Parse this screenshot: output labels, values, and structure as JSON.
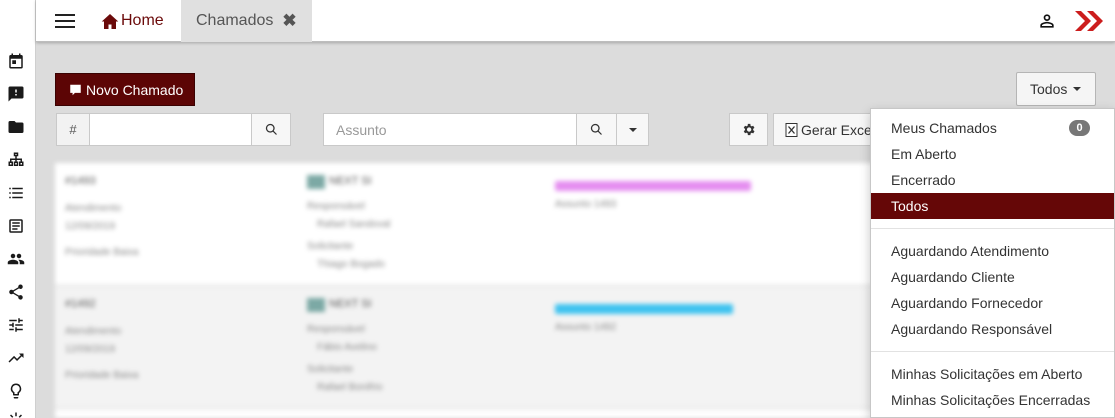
{
  "tabs": {
    "home_label": "Home",
    "chamados_label": "Chamados",
    "close_glyph": "✖"
  },
  "icons": {
    "rail": [
      "calendar-icon",
      "feedback-icon",
      "folder-icon",
      "sitemap-icon",
      "list-icon",
      "document-list-icon",
      "people-icon",
      "share-icon",
      "tune-icon",
      "trending-up-icon",
      "lightbulb-icon"
    ],
    "top": [
      "menu-icon",
      "home-icon",
      "user-icon",
      "brand-logo-icon"
    ]
  },
  "toolbar": {
    "novo_label": "Novo Chamado",
    "filter_label": "Todos",
    "number_addon": "#",
    "assunto_placeholder": "Assunto",
    "excel_label": "Gerar Excel"
  },
  "menu": {
    "group1": [
      {
        "label": "Meus Chamados",
        "badge": "0"
      },
      {
        "label": "Em Aberto"
      },
      {
        "label": "Encerrado"
      },
      {
        "label": "Todos",
        "active": true
      }
    ],
    "group2": [
      {
        "label": "Aguardando Atendimento"
      },
      {
        "label": "Aguardando Cliente"
      },
      {
        "label": "Aguardando Fornecedor"
      },
      {
        "label": "Aguardando Responsável"
      }
    ],
    "group3": [
      {
        "label": "Minhas Solicitações em Aberto"
      },
      {
        "label": "Minhas Solicitações Encerradas"
      }
    ]
  },
  "colors": {
    "primary": "#650707",
    "badge": "#777777",
    "tag_pink": "#e58ef0",
    "tag_blue": "#3fc3f0"
  }
}
